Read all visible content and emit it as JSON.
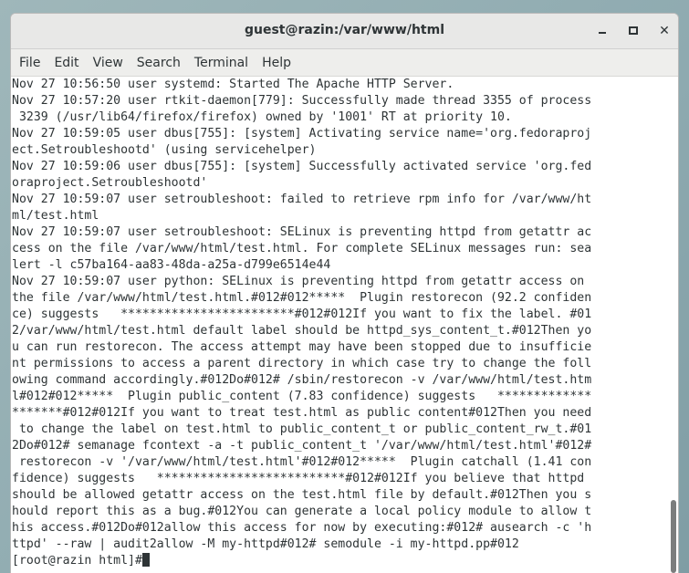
{
  "window": {
    "title": "guest@razin:/var/www/html"
  },
  "menu": [
    "File",
    "Edit",
    "View",
    "Search",
    "Terminal",
    "Help"
  ],
  "terminal": {
    "lines": [
      "Nov 27 10:56:50 user systemd: Started The Apache HTTP Server.",
      "Nov 27 10:57:20 user rtkit-daemon[779]: Successfully made thread 3355 of process",
      " 3239 (/usr/lib64/firefox/firefox) owned by '1001' RT at priority 10.",
      "Nov 27 10:59:05 user dbus[755]: [system] Activating service name='org.fedoraproj",
      "ect.Setroubleshootd' (using servicehelper)",
      "Nov 27 10:59:06 user dbus[755]: [system] Successfully activated service 'org.fed",
      "oraproject.Setroubleshootd'",
      "Nov 27 10:59:07 user setroubleshoot: failed to retrieve rpm info for /var/www/ht",
      "ml/test.html",
      "Nov 27 10:59:07 user setroubleshoot: SELinux is preventing httpd from getattr ac",
      "cess on the file /var/www/html/test.html. For complete SELinux messages run: sea",
      "lert -l c57ba164-aa83-48da-a25a-d799e6514e44",
      "Nov 27 10:59:07 user python: SELinux is preventing httpd from getattr access on",
      "the file /var/www/html/test.html.#012#012*****  Plugin restorecon (92.2 confiden",
      "ce) suggests   ************************#012#012If you want to fix the label. #01",
      "2/var/www/html/test.html default label should be httpd_sys_content_t.#012Then yo",
      "u can run restorecon. The access attempt may have been stopped due to insufficie",
      "nt permissions to access a parent directory in which case try to change the foll",
      "owing command accordingly.#012Do#012# /sbin/restorecon -v /var/www/html/test.htm",
      "l#012#012*****  Plugin public_content (7.83 confidence) suggests   *************",
      "*******#012#012If you want to treat test.html as public content#012Then you need",
      " to change the label on test.html to public_content_t or public_content_rw_t.#01",
      "2Do#012# semanage fcontext -a -t public_content_t '/var/www/html/test.html'#012#",
      " restorecon -v '/var/www/html/test.html'#012#012*****  Plugin catchall (1.41 con",
      "fidence) suggests   **************************#012#012If you believe that httpd",
      "should be allowed getattr access on the test.html file by default.#012Then you s",
      "hould report this as a bug.#012You can generate a local policy module to allow t",
      "his access.#012Do#012allow this access for now by executing:#012# ausearch -c 'h",
      "ttpd' --raw | audit2allow -M my-httpd#012# semodule -i my-httpd.pp#012"
    ],
    "prompt": "[root@razin html]#"
  }
}
